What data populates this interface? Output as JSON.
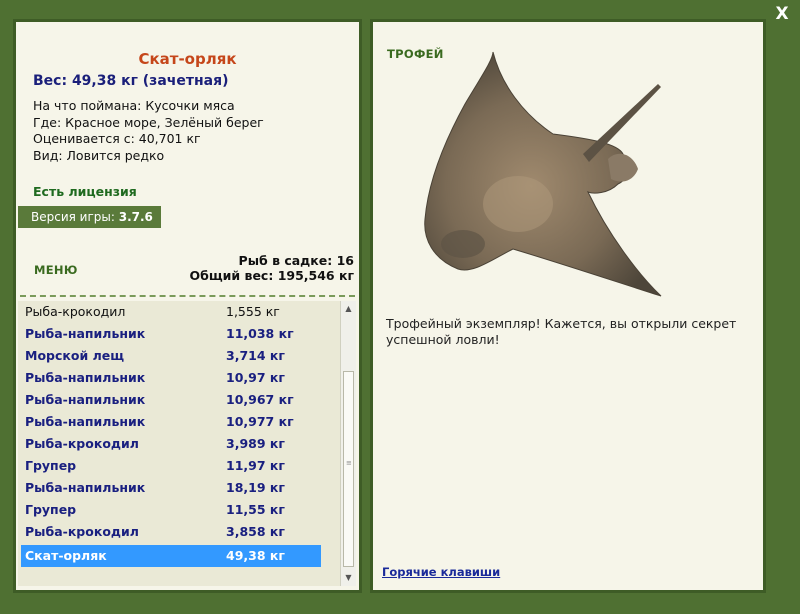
{
  "close_label": "X",
  "fish": {
    "title": "Скат-орляк",
    "weight": "Вес: 49,38 кг (зачетная)",
    "bait": "На что поймана: Кусочки мяса",
    "location": "Где: Красное море, Зелёный берег",
    "rated_from": "Оценивается с: 40,701 кг",
    "rarity": "Вид: Ловится редко"
  },
  "license": "Есть лицензия",
  "version": {
    "label": "Версия игры:",
    "value": "3.7.6"
  },
  "menu_label": "МЕНЮ",
  "keep": {
    "count": "Рыб в садке: 16",
    "total": "Общий вес: 195,546 кг"
  },
  "catch_list": [
    {
      "name": "Рыба-крокодил",
      "weight": "1,555 кг",
      "style": "plain"
    },
    {
      "name": "Рыба-напильник",
      "weight": "11,038 кг",
      "style": "bold"
    },
    {
      "name": "Морской лещ",
      "weight": "3,714 кг",
      "style": "bold"
    },
    {
      "name": "Рыба-напильник",
      "weight": "10,97 кг",
      "style": "bold"
    },
    {
      "name": "Рыба-напильник",
      "weight": "10,967 кг",
      "style": "bold"
    },
    {
      "name": "Рыба-напильник",
      "weight": "10,977 кг",
      "style": "bold"
    },
    {
      "name": "Рыба-крокодил",
      "weight": "3,989 кг",
      "style": "bold"
    },
    {
      "name": "Групер",
      "weight": "11,97 кг",
      "style": "bold"
    },
    {
      "name": "Рыба-напильник",
      "weight": "18,19 кг",
      "style": "bold"
    },
    {
      "name": "Групер",
      "weight": "11,55 кг",
      "style": "bold"
    },
    {
      "name": "Рыба-крокодил",
      "weight": "3,858 кг",
      "style": "bold"
    },
    {
      "name": "Скат-орляк",
      "weight": "49,38 кг",
      "style": "selected"
    }
  ],
  "trophy": {
    "label": "ТРОФЕЙ",
    "text": "Трофейный экземпляр! Кажется, вы открыли секрет успешной ловли!"
  },
  "hotkeys_label": "Горячие клавиши",
  "colors": {
    "background": "#4f7032",
    "panel": "#f6f5e9",
    "title": "#c5461a",
    "accent_blue": "#1a2080",
    "selected": "#3399ff"
  }
}
